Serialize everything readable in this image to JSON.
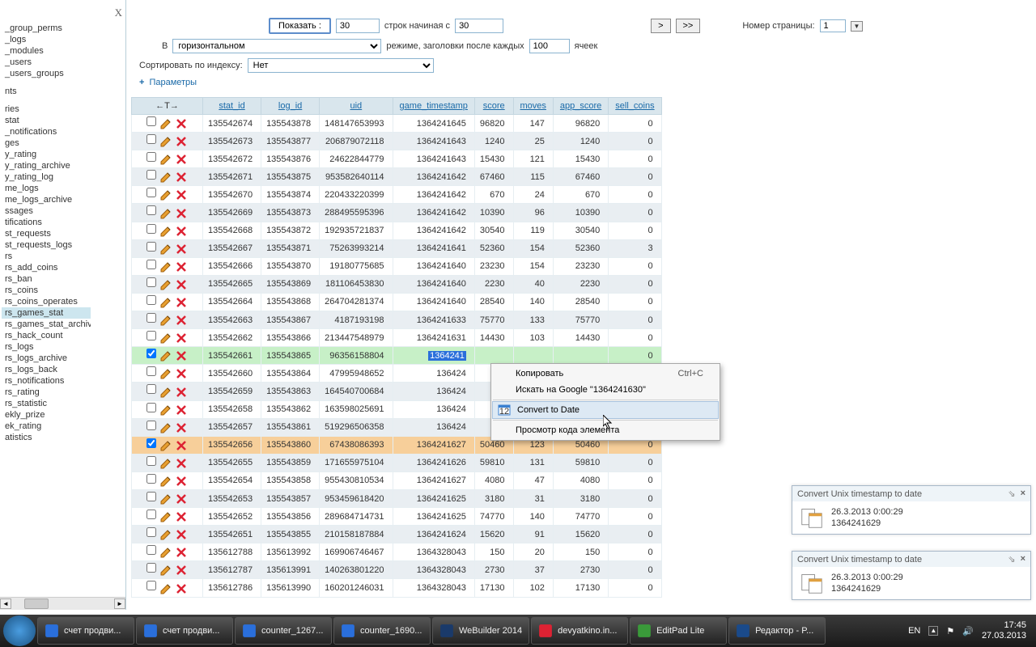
{
  "sidebar": {
    "close": "X",
    "items": [
      "_group_perms",
      "_logs",
      "_modules",
      "_users",
      "_users_groups",
      "nts",
      "ries",
      "stat",
      "_notifications",
      "ges",
      "y_rating",
      "y_rating_archive",
      "y_rating_log",
      "me_logs",
      "me_logs_archive",
      "ssages",
      "tifications",
      "st_requests",
      "st_requests_logs",
      "rs",
      "rs_add_coins",
      "rs_ban",
      "rs_coins",
      "rs_coins_operates",
      "rs_games_stat",
      "rs_games_stat_archive",
      "rs_hack_count",
      "rs_logs",
      "rs_logs_archive",
      "rs_logs_back",
      "rs_notifications",
      "rs_rating",
      "rs_statistic",
      "ekly_prize",
      "ek_rating",
      "atistics"
    ],
    "selected_index": 24
  },
  "toolbar": {
    "show_btn": "Показать :",
    "show_val": "30",
    "rows_from_label": "строк начиная с",
    "rows_from_val": "30",
    "nav_next": ">",
    "nav_last": ">>",
    "page_label": "Номер страницы:",
    "page_val": "1",
    "row2_prefix": "В",
    "mode_value": "горизонтальном",
    "row2_mid": "режиме, заголовки после каждых",
    "cells_val": "100",
    "row2_end": "ячеек",
    "sort_label": "Сортировать по индексу:",
    "sort_value": "Нет",
    "params_plus": "+",
    "params_link": "Параметры"
  },
  "columns": [
    "stat_id",
    "log_id",
    "uid",
    "game_timestamp",
    "score",
    "moves",
    "app_score",
    "sell_coins"
  ],
  "rows": [
    {
      "c": [
        "135542674",
        "135543878",
        "148147653993",
        "1364241645",
        "96820",
        "147",
        "96820",
        "0"
      ],
      "chk": false
    },
    {
      "c": [
        "135542673",
        "135543877",
        "206879072118",
        "1364241643",
        "1240",
        "25",
        "1240",
        "0"
      ],
      "chk": false
    },
    {
      "c": [
        "135542672",
        "135543876",
        "24622844779",
        "1364241643",
        "15430",
        "121",
        "15430",
        "0"
      ],
      "chk": false
    },
    {
      "c": [
        "135542671",
        "135543875",
        "953582640114",
        "1364241642",
        "67460",
        "115",
        "67460",
        "0"
      ],
      "chk": false
    },
    {
      "c": [
        "135542670",
        "135543874",
        "220433220399",
        "1364241642",
        "670",
        "24",
        "670",
        "0"
      ],
      "chk": false
    },
    {
      "c": [
        "135542669",
        "135543873",
        "288495595396",
        "1364241642",
        "10390",
        "96",
        "10390",
        "0"
      ],
      "chk": false
    },
    {
      "c": [
        "135542668",
        "135543872",
        "192935721837",
        "1364241642",
        "30540",
        "119",
        "30540",
        "0"
      ],
      "chk": false
    },
    {
      "c": [
        "135542667",
        "135543871",
        "75263993214",
        "1364241641",
        "52360",
        "154",
        "52360",
        "3"
      ],
      "chk": false
    },
    {
      "c": [
        "135542666",
        "135543870",
        "19180775685",
        "1364241640",
        "23230",
        "154",
        "23230",
        "0"
      ],
      "chk": false
    },
    {
      "c": [
        "135542665",
        "135543869",
        "181106453830",
        "1364241640",
        "2230",
        "40",
        "2230",
        "0"
      ],
      "chk": false
    },
    {
      "c": [
        "135542664",
        "135543868",
        "264704281374",
        "1364241640",
        "28540",
        "140",
        "28540",
        "0"
      ],
      "chk": false
    },
    {
      "c": [
        "135542663",
        "135543867",
        "4187193198",
        "1364241633",
        "75770",
        "133",
        "75770",
        "0"
      ],
      "chk": false
    },
    {
      "c": [
        "135542662",
        "135543866",
        "213447548979",
        "1364241631",
        "14430",
        "103",
        "14430",
        "0"
      ],
      "chk": false
    },
    {
      "c": [
        "135542661",
        "135543865",
        "96356158804",
        "1364241630",
        "",
        "",
        "",
        "0"
      ],
      "chk": true,
      "hl": "green",
      "seltext": "1364241"
    },
    {
      "c": [
        "135542660",
        "135543864",
        "47995948652",
        "136424",
        "",
        "",
        "",
        "0"
      ],
      "chk": false
    },
    {
      "c": [
        "135542659",
        "135543863",
        "164540700684",
        "136424",
        "",
        "",
        "",
        "0"
      ],
      "chk": false
    },
    {
      "c": [
        "135542658",
        "135543862",
        "163598025691",
        "136424",
        "",
        "",
        "",
        "0"
      ],
      "chk": false
    },
    {
      "c": [
        "135542657",
        "135543861",
        "519296506358",
        "136424",
        "",
        "",
        "",
        "0"
      ],
      "chk": false
    },
    {
      "c": [
        "135542656",
        "135543860",
        "67438086393",
        "1364241627",
        "50460",
        "123",
        "50460",
        "0"
      ],
      "chk": true,
      "hl": "orange"
    },
    {
      "c": [
        "135542655",
        "135543859",
        "171655975104",
        "1364241626",
        "59810",
        "131",
        "59810",
        "0"
      ],
      "chk": false
    },
    {
      "c": [
        "135542654",
        "135543858",
        "955430810534",
        "1364241627",
        "4080",
        "47",
        "4080",
        "0"
      ],
      "chk": false
    },
    {
      "c": [
        "135542653",
        "135543857",
        "953459618420",
        "1364241625",
        "3180",
        "31",
        "3180",
        "0"
      ],
      "chk": false
    },
    {
      "c": [
        "135542652",
        "135543856",
        "289684714731",
        "1364241625",
        "74770",
        "140",
        "74770",
        "0"
      ],
      "chk": false
    },
    {
      "c": [
        "135542651",
        "135543855",
        "210158187884",
        "1364241624",
        "15620",
        "91",
        "15620",
        "0"
      ],
      "chk": false
    },
    {
      "c": [
        "135612788",
        "135613992",
        "169906746467",
        "1364328043",
        "150",
        "20",
        "150",
        "0"
      ],
      "chk": false
    },
    {
      "c": [
        "135612787",
        "135613991",
        "140263801220",
        "1364328043",
        "2730",
        "37",
        "2730",
        "0"
      ],
      "chk": false
    },
    {
      "c": [
        "135612786",
        "135613990",
        "160201246031",
        "1364328043",
        "17130",
        "102",
        "17130",
        "0"
      ],
      "chk": false
    }
  ],
  "ctx": {
    "copy": "Копировать",
    "copy_sc": "Ctrl+C",
    "search": "Искать на Google \"1364241630\"",
    "convert": "Convert to Date",
    "inspect": "Просмотр кода элемента"
  },
  "notif": {
    "title": "Convert Unix timestamp to date",
    "line1": "26.3.2013 0:00:29",
    "line2": "1364241629"
  },
  "taskbar": {
    "items": [
      "счет продви...",
      "счет продви...",
      "counter_1267...",
      "counter_1690...",
      "WeBuilder 2014",
      "devyatkino.in...",
      "EditPad Lite",
      "Редактор - P..."
    ],
    "lang": "EN",
    "time": "17:45",
    "date": "27.03.2013"
  }
}
